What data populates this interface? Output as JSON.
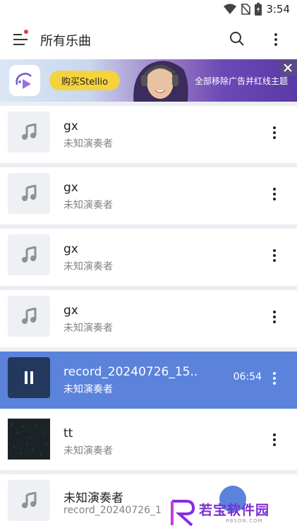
{
  "status_bar": {
    "time": "3:54"
  },
  "app_bar": {
    "title": "所有乐曲"
  },
  "ad": {
    "buy_label": "购买Stellio",
    "promo_text": "全部移除广告并红线主题"
  },
  "tracks": [
    {
      "title": "gx",
      "artist": "未知演奏者"
    },
    {
      "title": "gx",
      "artist": "未知演奏者"
    },
    {
      "title": "gx",
      "artist": "未知演奏者"
    },
    {
      "title": "gx",
      "artist": "未知演奏者"
    },
    {
      "title": "record_20240726_15..",
      "artist": "未知演奏者",
      "duration": "06:54",
      "playing": true
    },
    {
      "title": "tt",
      "artist": "未知演奏者"
    },
    {
      "title": "未知演奏者",
      "artist": "record_20240726_1"
    }
  ],
  "watermark": {
    "text": "若宝软件园",
    "sub": "RBSON.COM"
  },
  "colors": {
    "accent": "#5b83dc",
    "ad_button": "#f5d33c",
    "notification_dot": "#e53935"
  }
}
